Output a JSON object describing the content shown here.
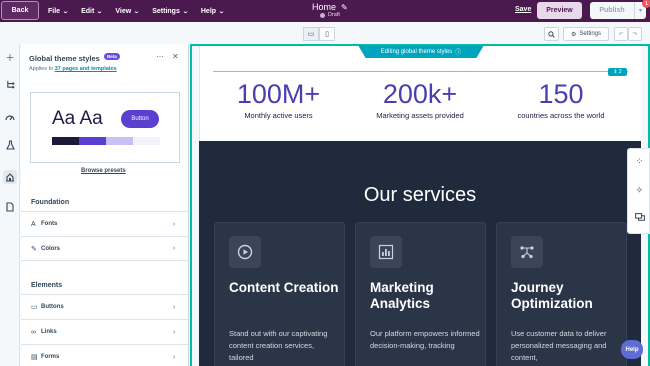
{
  "topbar": {
    "back_label": "Back",
    "menus": [
      {
        "label": "File"
      },
      {
        "label": "Edit"
      },
      {
        "label": "View"
      },
      {
        "label": "Settings"
      },
      {
        "label": "Help"
      }
    ],
    "page_title": "Home",
    "status": "Draft",
    "save_label": "Save",
    "preview_label": "Preview",
    "publish_label": "Publish",
    "notification_count": "1"
  },
  "rail": {
    "icons": [
      "add-icon",
      "tree-icon",
      "speed-icon",
      "flask-icon",
      "theme-icon",
      "page-icon"
    ]
  },
  "panel": {
    "title": "Global theme styles",
    "badge": "Beta",
    "applies_prefix": "Applies to",
    "applies_link": "37 pages and templates",
    "preview": {
      "type_sample": "Aa Aa",
      "button_label": "Button",
      "swatches": [
        "#1c1a3b",
        "#5a3fd1",
        "#c9c1f3",
        "#f3f1fc"
      ]
    },
    "browse_label": "Browse presets",
    "foundation_heading": "Foundation",
    "foundation_items": [
      {
        "label": "Fonts",
        "icon": "font-icon"
      },
      {
        "label": "Colors",
        "icon": "paint-icon"
      }
    ],
    "elements_heading": "Elements",
    "element_items": [
      {
        "label": "Buttons",
        "icon": "button-icon"
      },
      {
        "label": "Links",
        "icon": "link-icon"
      },
      {
        "label": "Forms",
        "icon": "form-icon"
      }
    ]
  },
  "toolbar": {
    "settings_label": "Settings"
  },
  "canvas": {
    "editing_banner": "Editing global theme styles",
    "section_handle": "2",
    "stats": [
      {
        "value": "100M+",
        "label": "Monthly active users"
      },
      {
        "value": "200k+",
        "label": "Marketing assets provided"
      },
      {
        "value": "150",
        "label": "countries across the world"
      }
    ],
    "services_title": "Our services",
    "cards": [
      {
        "icon": "play-icon",
        "title": "Content Creation",
        "body": "Stand out with our captivating content creation services, tailored"
      },
      {
        "icon": "bar-chart-icon",
        "title": "Marketing Analytics",
        "body": "Our platform empowers informed decision-making, tracking"
      },
      {
        "icon": "route-icon",
        "title": "Journey Optimization",
        "body": "Use customer data to deliver personalized messaging and content,"
      }
    ]
  },
  "help_label": "Help",
  "colors": {
    "topbar": "#4a1a4f",
    "accent": "#00bda5",
    "stat_number": "#4a3fb0",
    "services_bg": "#1f2a3d"
  }
}
